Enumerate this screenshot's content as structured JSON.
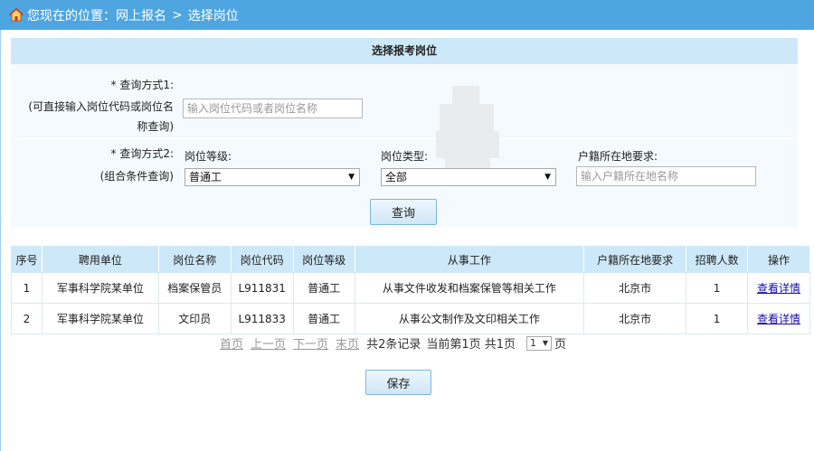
{
  "header": {
    "location_prefix": "您现在的位置：",
    "crumb1": "网上报名",
    "separator": ">",
    "crumb2": "选择岗位"
  },
  "search": {
    "title": "选择报考岗位",
    "mode1_label": "查询方式1:",
    "mode1_desc_line1": "(可直接输入岗位代码或岗位名",
    "mode1_desc_line2": "称查询)",
    "mode1_placeholder": "输入岗位代码或者岗位名称",
    "mode2_label": "查询方式2:",
    "mode2_desc": "(组合条件查询)",
    "level_label": "岗位等级:",
    "level_value": "普通工",
    "type_label": "岗位类型:",
    "type_value": "全部",
    "residence_label": "户籍所在地要求:",
    "residence_placeholder": "输入户籍所在地名称",
    "required_mark": "*",
    "query_button": "查询"
  },
  "table": {
    "headers": [
      "序号",
      "聘用单位",
      "岗位名称",
      "岗位代码",
      "岗位等级",
      "从事工作",
      "户籍所在地要求",
      "招聘人数",
      "操作"
    ],
    "rows": [
      [
        "1",
        "军事科学院某单位",
        "档案保管员",
        "L911831",
        "普通工",
        "从事文件收发和档案保管等相关工作",
        "北京市",
        "1",
        "查看详情"
      ],
      [
        "2",
        "军事科学院某单位",
        "文印员",
        "L911833",
        "普通工",
        "从事公文制作及文印相关工作",
        "北京市",
        "1",
        "查看详情"
      ]
    ]
  },
  "pager": {
    "first": "首页",
    "prev": "上一页",
    "next": "下一页",
    "last": "末页",
    "total": "共2条记录",
    "current": "当前第1页 共1页",
    "page_select": "1",
    "page_unit": "页"
  },
  "save_button": "保存",
  "colors": {
    "topbar": "#4ea5e0",
    "header_bg": "#cde8f8",
    "link": "#1a0dab"
  }
}
